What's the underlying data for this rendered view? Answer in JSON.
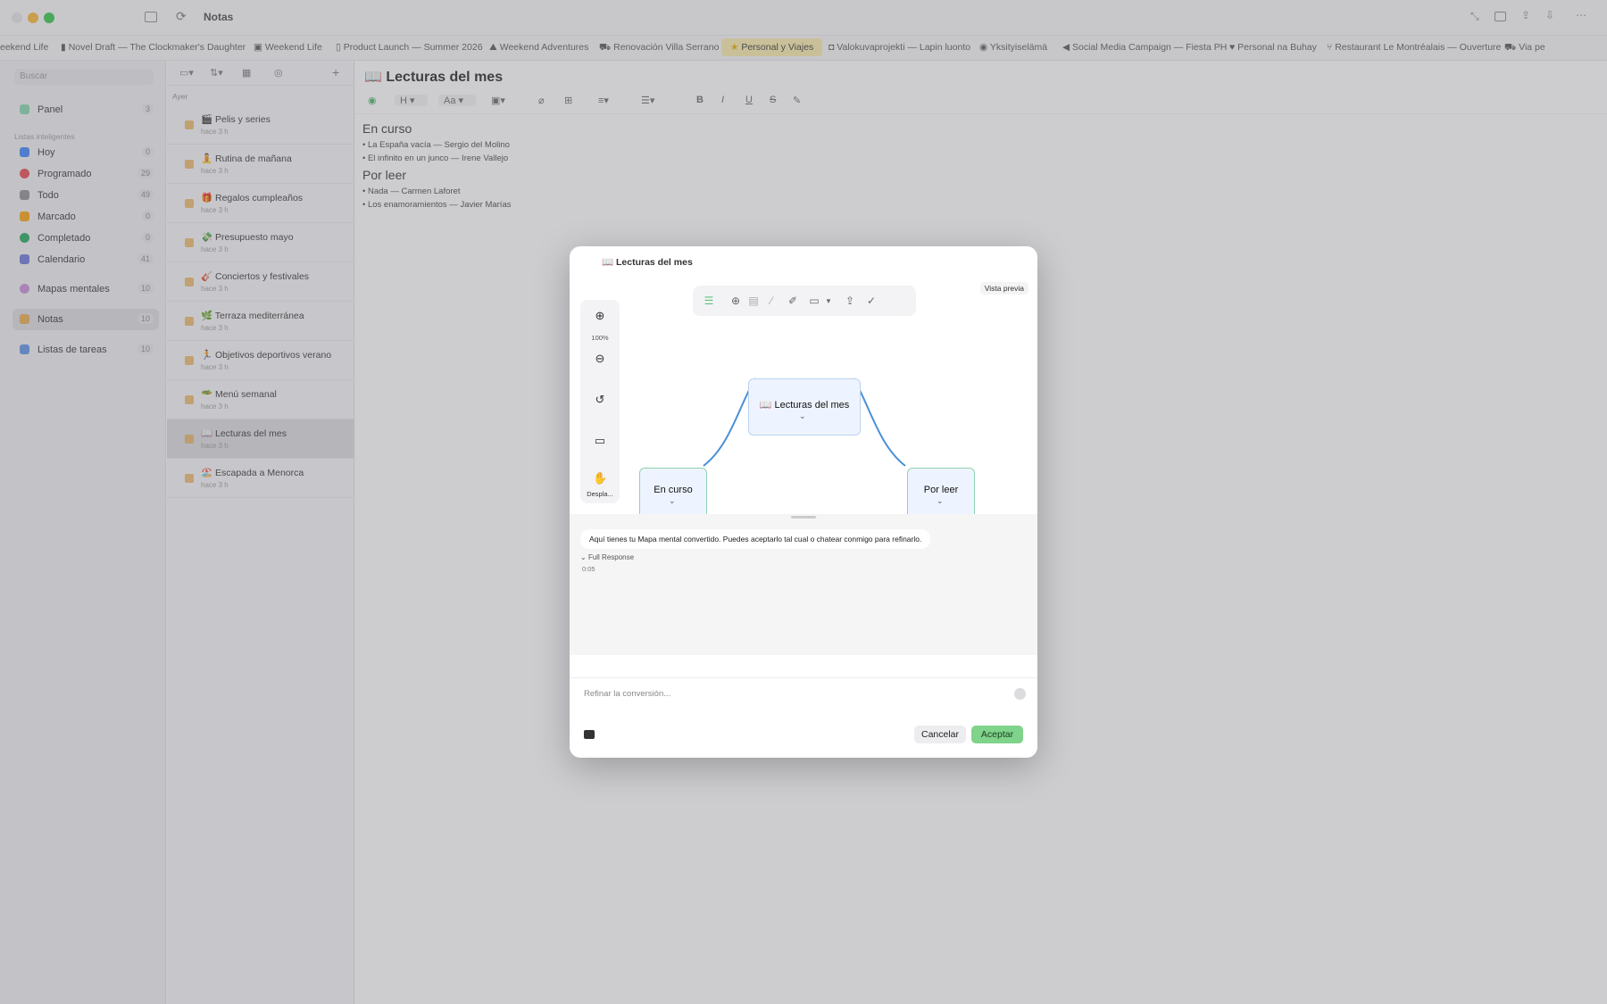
{
  "app": {
    "title": "Notas"
  },
  "tabs": [
    {
      "label": "eekend Life",
      "icon": ""
    },
    {
      "label": "Novel Draft — The Clockmaker's Daughter",
      "icon": "book-icon"
    },
    {
      "label": "Weekend Life",
      "icon": "image-icon"
    },
    {
      "label": "Product Launch — Summer 2026",
      "icon": "doc-icon"
    },
    {
      "label": "Weekend Adventures",
      "icon": "hiker-icon"
    },
    {
      "label": "Renovación Villa Serrano",
      "icon": "car-icon"
    },
    {
      "label": "Personal y Viajes",
      "icon": "star-icon",
      "active": true
    },
    {
      "label": "Valokuvaprojekti — Lapin luonto",
      "icon": "camera-icon"
    },
    {
      "label": "Yksityiselämä",
      "icon": "circle-icon"
    },
    {
      "label": "Social Media Campaign — Fiesta PH",
      "icon": "megaphone-icon"
    },
    {
      "label": "Personal na Buhay",
      "icon": "heart-icon"
    },
    {
      "label": "Restaurant Le Montréalais — Ouverture",
      "icon": "fork-icon"
    },
    {
      "label": "Via pe",
      "icon": "car-icon"
    }
  ],
  "sidebar": {
    "search_placeholder": "Buscar",
    "panel": {
      "label": "Panel",
      "count": "3"
    },
    "smart_lists_header": "Listas inteligentes",
    "items": [
      {
        "label": "Hoy",
        "count": "0",
        "color": "#3b82f6"
      },
      {
        "label": "Programado",
        "count": "29",
        "color": "#e5484d"
      },
      {
        "label": "Todo",
        "count": "49",
        "color": "#8a8a8f"
      },
      {
        "label": "Marcado",
        "count": "0",
        "color": "#f59e0b"
      },
      {
        "label": "Completado",
        "count": "0",
        "color": "#22a35a"
      },
      {
        "label": "Calendario",
        "count": "41",
        "color": "#6b72d6"
      }
    ],
    "mindmaps": {
      "label": "Mapas mentales",
      "count": "10"
    },
    "notes": {
      "label": "Notas",
      "count": "10"
    },
    "tasks": {
      "label": "Listas de tareas",
      "count": "10"
    }
  },
  "notelist": {
    "group": "Ayer",
    "notes": [
      {
        "title": "🎬 Pelis y series",
        "sub": "hace 3 h"
      },
      {
        "title": "🧘 Rutina de mañana",
        "sub": "hace 3 h"
      },
      {
        "title": "🎁 Regalos cumpleaños",
        "sub": "hace 3 h"
      },
      {
        "title": "💸 Presupuesto mayo",
        "sub": "hace 3 h"
      },
      {
        "title": "🎸 Conciertos y festivales",
        "sub": "hace 3 h"
      },
      {
        "title": "🌿 Terraza mediterránea",
        "sub": "hace 3 h"
      },
      {
        "title": "🏃 Objetivos deportivos verano",
        "sub": "hace 3 h"
      },
      {
        "title": "🥗 Menú semanal",
        "sub": "hace 3 h"
      },
      {
        "title": "📖 Lecturas del mes",
        "sub": "hace 3 h",
        "selected": true
      },
      {
        "title": "🏖️ Escapada a Menorca",
        "sub": "hace 3 h"
      }
    ]
  },
  "editor": {
    "title": "📖 Lecturas del mes",
    "toolbar": {
      "h": "H",
      "aa": "Aa",
      "b": "B",
      "i": "I",
      "u": "U",
      "s": "S"
    },
    "sections": [
      {
        "heading": "En curso",
        "items": [
          "• La España vacía — Sergio del Molino",
          "• El infinito en un junco — Irene Vallejo"
        ]
      },
      {
        "heading": "Por leer",
        "items": [
          "• Nada — Carmen Laforet",
          "• Los enamoramientos — Javier Marías"
        ]
      }
    ]
  },
  "modal": {
    "title": "📖 Lecturas del mes",
    "preview_label": "Vista previa",
    "zoom": "100%",
    "pan_label": "Despla...",
    "nodes": {
      "root": "📖 Lecturas del mes",
      "left": "En curso",
      "right": "Por leer"
    },
    "message": "Aquí tienes tu Mapa mental convertido. Puedes aceptarlo tal cual o chatear conmigo para refinarlo.",
    "full_response": "Full Response",
    "elapsed": "0:05",
    "input_placeholder": "Refinar la conversión...",
    "cancel": "Cancelar",
    "accept": "Aceptar",
    "colors": {
      "accept": "#7fd38a",
      "edge": "#4a8fd6",
      "node_border_green": "#8fd3b0"
    }
  }
}
